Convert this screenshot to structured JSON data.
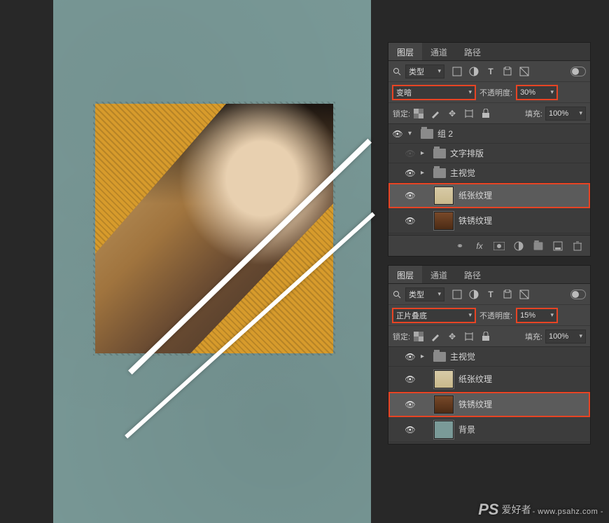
{
  "panel_tabs": {
    "layers": "图层",
    "channels": "通道",
    "paths": "路径"
  },
  "filter": {
    "label": "类型",
    "search_icon": "search"
  },
  "blend": {
    "top_mode": "变暗",
    "bottom_mode": "正片叠底",
    "opacity_label": "不透明度:",
    "top_opacity": "30%",
    "bottom_opacity": "15%",
    "lock_label": "锁定:",
    "fill_label": "填充:",
    "fill_value": "100%"
  },
  "layers_top": {
    "group": "组 2",
    "text_group": "文字排版",
    "main_group": "主视觉",
    "paper_tex": "纸张纹理",
    "rust_tex": "铁锈纹理"
  },
  "layers_bottom": {
    "main_group": "主视觉",
    "paper_tex": "纸张纹理",
    "rust_tex": "铁锈纹理",
    "bg": "背景"
  },
  "bottom_icons": {
    "link": "link",
    "fx": "fx",
    "mask": "mask",
    "adj": "adj",
    "group": "group",
    "new": "new",
    "trash": "trash"
  },
  "watermark": {
    "brand": "PS",
    "cn": "爱好者",
    "url": "- www.psahz.com -"
  }
}
